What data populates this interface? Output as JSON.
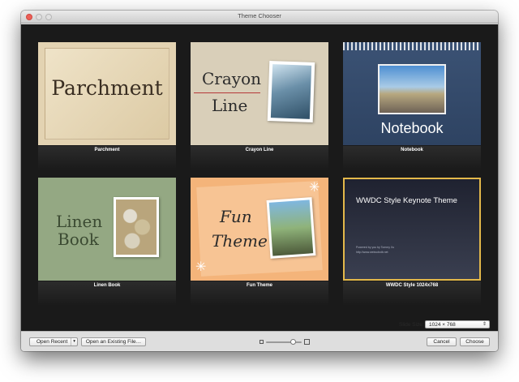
{
  "window": {
    "title": "Theme Chooser"
  },
  "themes": [
    {
      "label": "Parchment",
      "display": "Parchment"
    },
    {
      "label": "Crayon Line",
      "display_line1": "Crayon",
      "display_line2": "Line"
    },
    {
      "label": "Notebook",
      "display": "Notebook"
    },
    {
      "label": "Linen Book",
      "display_line1": "Linen",
      "display_line2": "Book"
    },
    {
      "label": "Fun Theme",
      "display_line1": "Fun",
      "display_line2": "Theme"
    },
    {
      "label": "WWDC Style 1024x768",
      "display": "WWDC Style Keynote Theme",
      "subtext1": "Powered by you by Tommy Xu",
      "subtext2": "http://www.weiwobotb.net",
      "selected": true
    }
  ],
  "controls": {
    "slide_size_label": "Slide Size:",
    "slide_size_value": "1024 × 768",
    "open_recent": "Open Recent",
    "open_existing": "Open an Existing File…",
    "cancel": "Cancel",
    "choose": "Choose"
  },
  "icons": {
    "dropdown": "▾",
    "updown": "⇕",
    "star": "✳"
  },
  "colors": {
    "selection": "#e3b84a",
    "gallery_bg": "#1a1a1a",
    "close_button": "#ec5f57"
  }
}
